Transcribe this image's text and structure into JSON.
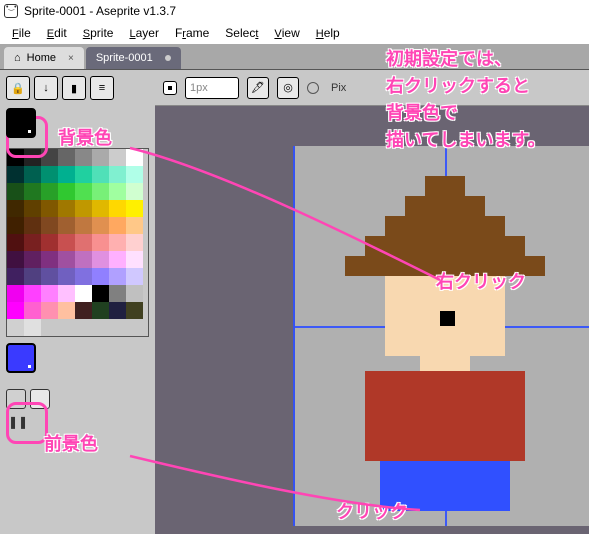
{
  "title": "Sprite-0001 - Aseprite v1.3.7",
  "menu": [
    "File",
    "Edit",
    "Sprite",
    "Layer",
    "Frame",
    "Select",
    "View",
    "Help"
  ],
  "tabs": {
    "home": "Home",
    "active": "Sprite-0001"
  },
  "toolbar_right": {
    "brush_size": "1px",
    "pixel_perfect_label": "Pix"
  },
  "palette": [
    [
      "#000000",
      "#222222",
      "#444444",
      "#666666",
      "#888888",
      "#aaaaaa",
      "#cccccc",
      "#ffffff"
    ],
    [
      "#003030",
      "#006050",
      "#009070",
      "#00b090",
      "#20d0a0",
      "#50e0b8",
      "#80f0d0",
      "#b0ffe8"
    ],
    [
      "#185018",
      "#207820",
      "#28a028",
      "#30c830",
      "#50e050",
      "#78f078",
      "#a0ffa0",
      "#d0ffd0"
    ],
    [
      "#402800",
      "#604000",
      "#805800",
      "#a07800",
      "#c09800",
      "#e0b800",
      "#ffd800",
      "#fff000"
    ],
    [
      "#402000",
      "#603010",
      "#804820",
      "#a06030",
      "#c07840",
      "#e09050",
      "#ffa860",
      "#ffc888"
    ],
    [
      "#501010",
      "#782020",
      "#a03030",
      "#c85050",
      "#e07070",
      "#f89090",
      "#ffb0b0",
      "#ffd0d0"
    ],
    [
      "#401040",
      "#602060",
      "#803080",
      "#a050a0",
      "#c070c0",
      "#e090e0",
      "#ffb0ff",
      "#ffe0ff"
    ],
    [
      "#402060",
      "#504080",
      "#6050a0",
      "#7060c0",
      "#8070e0",
      "#9080ff",
      "#b0a0ff",
      "#d0c8ff"
    ],
    [
      "#f000f0",
      "#ff40ff",
      "#ff80ff",
      "#ffc0ff",
      "#ffffff",
      "#000000",
      "#808080",
      "#c0c0c0"
    ],
    [
      "#ff00ff",
      "#ff60d0",
      "#ff90b0",
      "#ffc0a0",
      "#402020",
      "#204020",
      "#202040",
      "#404020"
    ],
    [
      "#d0d0d0",
      "#e0e0e0",
      "#",
      "#",
      "#",
      "#",
      "#",
      "#"
    ]
  ],
  "colors": {
    "fg": "#000000",
    "bg": "#3a3aff",
    "accent_annotation": "#ff45b5",
    "canvas_bg": "#6a6472",
    "sprite_bg": "#b0b0b0"
  },
  "annotations": {
    "bg_label": "背景色",
    "fg_label": "前景色",
    "top_text": "初期設定では、\n右クリックすると\n背景色で\n描いてしまいます。",
    "right_click": "右クリック",
    "click": "クリック"
  },
  "left_toolbar_icons": [
    "lock-icon",
    "down-arrow-icon",
    "new-icon",
    "menu-icon"
  ]
}
